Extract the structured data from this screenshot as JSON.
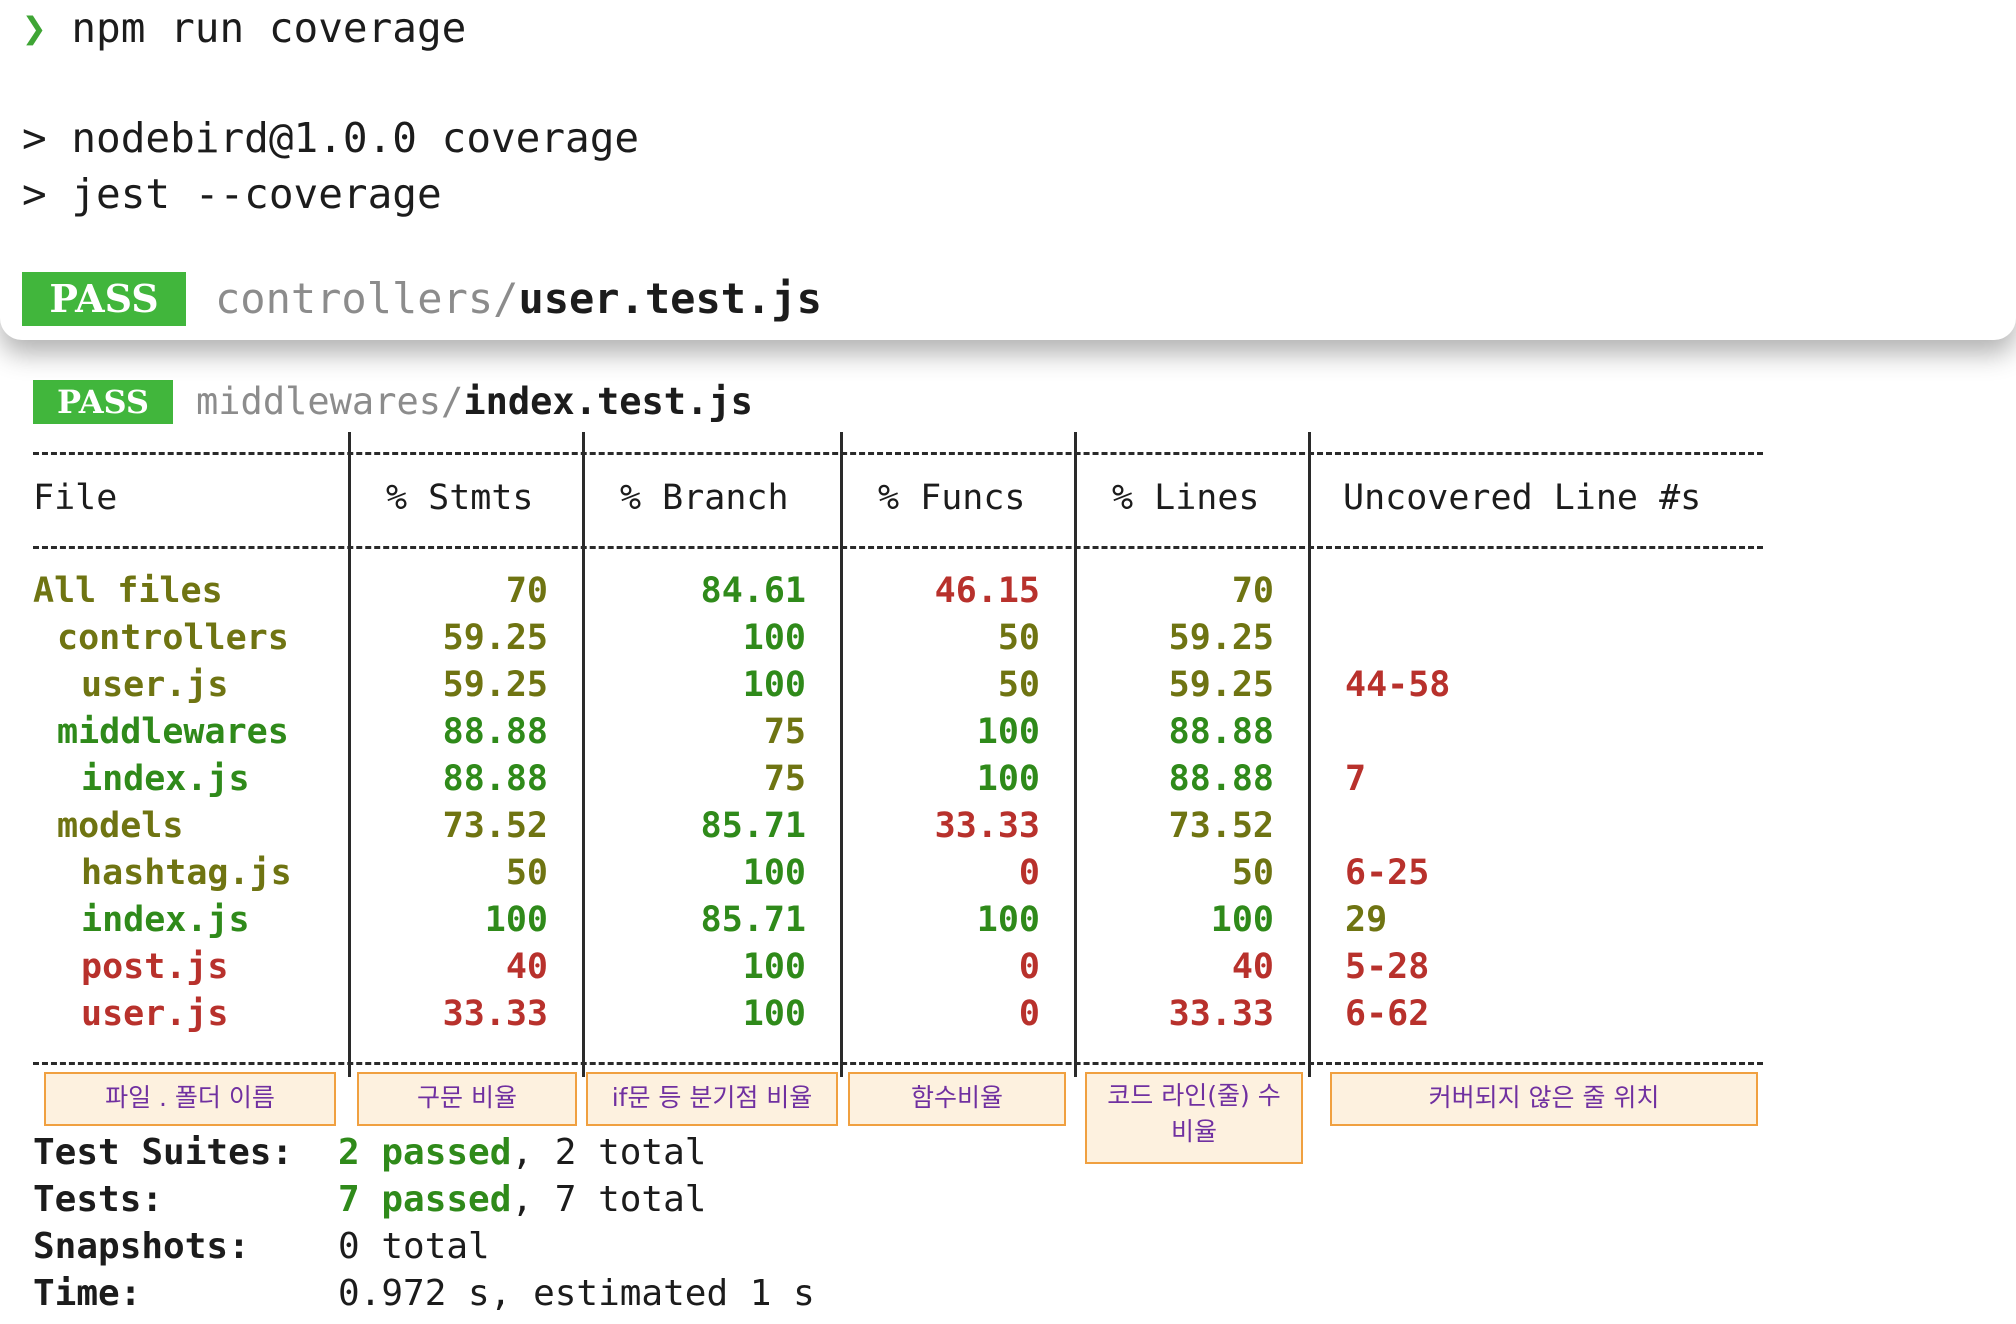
{
  "terminal": {
    "prompt": "❯",
    "command": "npm run coverage",
    "script_line1": "> nodebird@1.0.0 coverage",
    "script_line2": "> jest --coverage"
  },
  "results": [
    {
      "badge": "PASS",
      "dir": "controllers/",
      "file": "user.test.js"
    },
    {
      "badge": "PASS",
      "dir": "middlewares/",
      "file": "index.test.js"
    }
  ],
  "table": {
    "headers": [
      "File",
      "% Stmts",
      "% Branch",
      "% Funcs",
      "% Lines",
      "Uncovered Line #s"
    ],
    "rows": [
      {
        "file": "All files",
        "stmts": "70",
        "branch": "84.61",
        "funcs": "46.15",
        "lines": "70",
        "uncovered": ""
      },
      {
        "file": "controllers",
        "stmts": "59.25",
        "branch": "100",
        "funcs": "50",
        "lines": "59.25",
        "uncovered": ""
      },
      {
        "file": "user.js",
        "stmts": "59.25",
        "branch": "100",
        "funcs": "50",
        "lines": "59.25",
        "uncovered": "44-58"
      },
      {
        "file": "middlewares",
        "stmts": "88.88",
        "branch": "75",
        "funcs": "100",
        "lines": "88.88",
        "uncovered": ""
      },
      {
        "file": "index.js",
        "stmts": "88.88",
        "branch": "75",
        "funcs": "100",
        "lines": "88.88",
        "uncovered": "7"
      },
      {
        "file": "models",
        "stmts": "73.52",
        "branch": "85.71",
        "funcs": "33.33",
        "lines": "73.52",
        "uncovered": ""
      },
      {
        "file": "hashtag.js",
        "stmts": "50",
        "branch": "100",
        "funcs": "0",
        "lines": "50",
        "uncovered": "6-25"
      },
      {
        "file": "index.js",
        "stmts": "100",
        "branch": "85.71",
        "funcs": "100",
        "lines": "100",
        "uncovered": "29"
      },
      {
        "file": "post.js",
        "stmts": "40",
        "branch": "100",
        "funcs": "0",
        "lines": "40",
        "uncovered": "5-28"
      },
      {
        "file": "user.js",
        "stmts": "33.33",
        "branch": "100",
        "funcs": "0",
        "lines": "33.33",
        "uncovered": "6-62"
      }
    ]
  },
  "annotations": [
    "파일 . 폴더 이름",
    "구문 비율",
    "if문 등 분기점 비율",
    "함수비율",
    "코드 라인(줄) 수 비율",
    "커버되지 않은 줄 위치"
  ],
  "summary": {
    "suites_label": "Test Suites:",
    "suites_passed": "2 passed",
    "suites_total": ", 2 total",
    "tests_label": "Tests:",
    "tests_passed": "7 passed",
    "tests_total": ", 7 total",
    "snapshots_label": "Snapshots:",
    "snapshots_value": "0 total",
    "time_label": "Time:",
    "time_value": "0.972 s, estimated 1 s"
  },
  "colors": {
    "pass_badge": "#41b63c",
    "olive": "#6f7412",
    "green": "#2f8a1a",
    "red": "#b8312c",
    "annotation_text": "#7030a0",
    "annotation_border": "#f0a040"
  }
}
